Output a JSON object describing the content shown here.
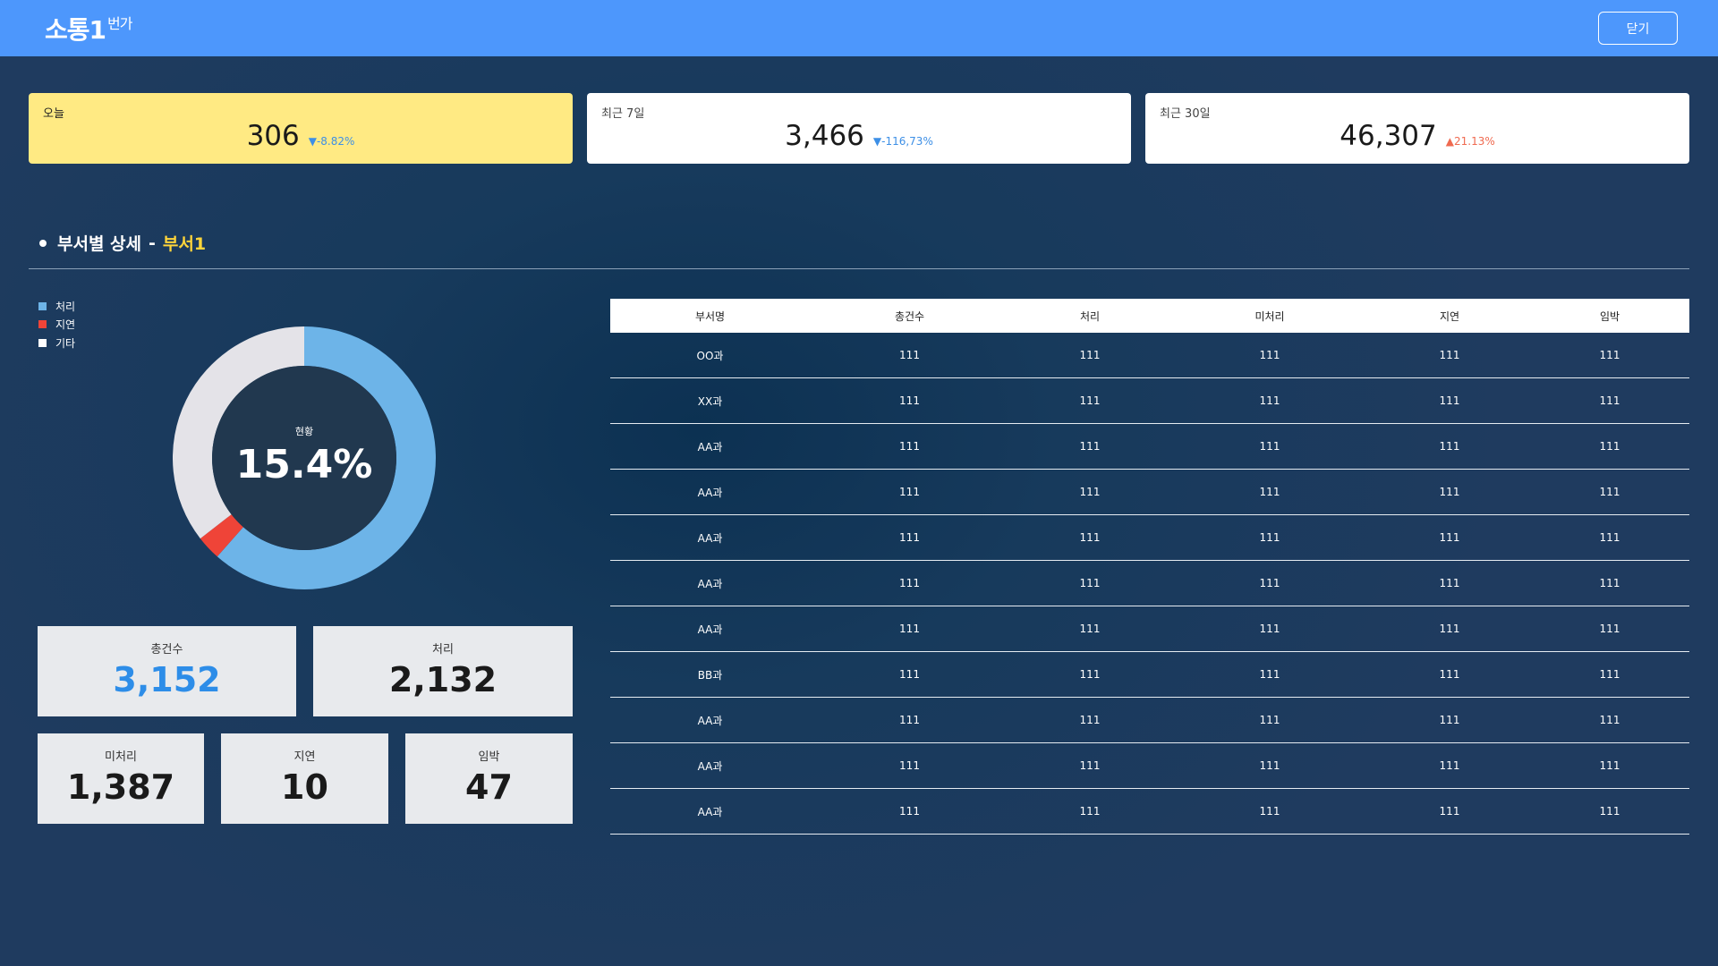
{
  "header": {
    "logo_main": "소통1",
    "logo_sub": "번가",
    "close_label": "닫기"
  },
  "stats": [
    {
      "label": "오늘",
      "value": "306",
      "delta": "▼-8.82%",
      "trend": "down"
    },
    {
      "label": "최근 7일",
      "value": "3,466",
      "delta": "▼-116,73%",
      "trend": "down"
    },
    {
      "label": "최근 30일",
      "value": "46,307",
      "delta": "▲21.13%",
      "trend": "up"
    }
  ],
  "section": {
    "title": "부서별 상세",
    "dash": "-",
    "dept": "부서1"
  },
  "legend": [
    {
      "label": "처리",
      "color": "#6db4e8"
    },
    {
      "label": "지연",
      "color": "#ef4438"
    },
    {
      "label": "기타",
      "color": "#ffffff"
    }
  ],
  "donut": {
    "center_label": "현황",
    "center_value": "15.4%",
    "segments": [
      {
        "name": "처리",
        "value": 61.5,
        "color": "#6db4e8"
      },
      {
        "name": "지연",
        "value": 3.0,
        "color": "#ef4438"
      },
      {
        "name": "기타",
        "value": 35.5,
        "color": "#e4e3e8"
      }
    ]
  },
  "metrics": {
    "total": {
      "label": "총건수",
      "value": "3,152"
    },
    "processed": {
      "label": "처리",
      "value": "2,132"
    },
    "unprocessed": {
      "label": "미처리",
      "value": "1,387"
    },
    "delayed": {
      "label": "지연",
      "value": "10"
    },
    "imminent": {
      "label": "임박",
      "value": "47"
    }
  },
  "table": {
    "headers": [
      "부서명",
      "총건수",
      "처리",
      "미처리",
      "지연",
      "임박"
    ],
    "rows": [
      [
        "OO과",
        "111",
        "111",
        "111",
        "111",
        "111"
      ],
      [
        "XX과",
        "111",
        "111",
        "111",
        "111",
        "111"
      ],
      [
        "AA과",
        "111",
        "111",
        "111",
        "111",
        "111"
      ],
      [
        "AA과",
        "111",
        "111",
        "111",
        "111",
        "111"
      ],
      [
        "AA과",
        "111",
        "111",
        "111",
        "111",
        "111"
      ],
      [
        "AA과",
        "111",
        "111",
        "111",
        "111",
        "111"
      ],
      [
        "AA과",
        "111",
        "111",
        "111",
        "111",
        "111"
      ],
      [
        "BB과",
        "111",
        "111",
        "111",
        "111",
        "111"
      ],
      [
        "AA과",
        "111",
        "111",
        "111",
        "111",
        "111"
      ],
      [
        "AA과",
        "111",
        "111",
        "111",
        "111",
        "111"
      ],
      [
        "AA과",
        "111",
        "111",
        "111",
        "111",
        "111"
      ]
    ]
  }
}
